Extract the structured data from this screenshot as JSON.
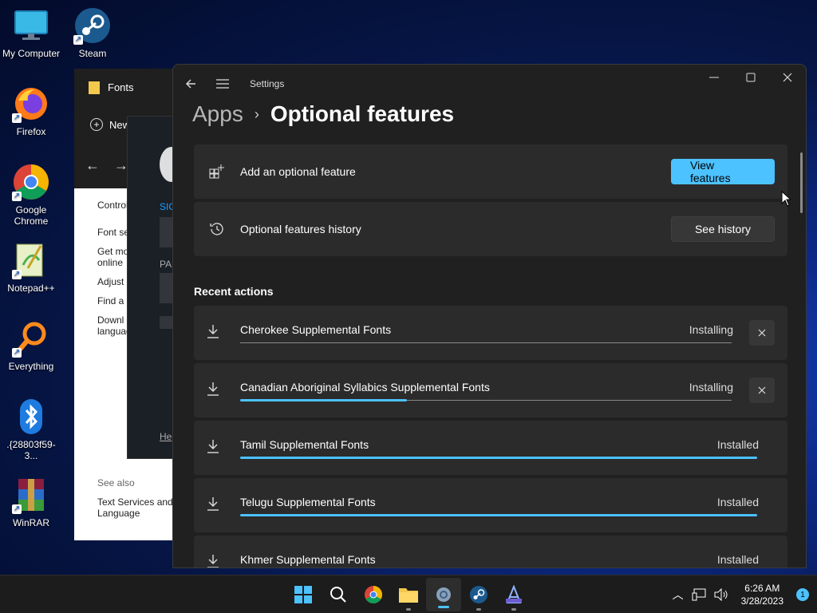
{
  "desktop_icons": [
    {
      "label": "My Computer"
    },
    {
      "label": "Steam"
    },
    {
      "label": "Firefox"
    },
    {
      "label": "Google Chrome"
    },
    {
      "label": "Notepad++"
    },
    {
      "label": "Everything"
    },
    {
      "label": ".{28803f59-3..."
    },
    {
      "label": "WinRAR"
    }
  ],
  "fonts_window": {
    "title": "Fonts",
    "new_label": "New",
    "body_items": [
      "Control",
      "Font se",
      "Get mo online",
      "Adjust",
      "Find a",
      "Downl languag"
    ],
    "see_also": "See also",
    "see_also_link": "Text Services and Language"
  },
  "steam_dialog": {
    "sign_label": "SIG",
    "pass_label": "PA",
    "help_label": "He"
  },
  "settings": {
    "app_title": "Settings",
    "breadcrumb_parent": "Apps",
    "breadcrumb_sep": "›",
    "breadcrumb_current": "Optional features",
    "add_feature": {
      "label": "Add an optional feature",
      "button": "View features"
    },
    "history": {
      "label": "Optional features history",
      "button": "See history"
    },
    "recent_title": "Recent actions",
    "actions": [
      {
        "name": "Cherokee Supplemental Fonts",
        "status": "Installing",
        "progress": 0,
        "cancelable": true
      },
      {
        "name": "Canadian Aboriginal Syllabics Supplemental Fonts",
        "status": "Installing",
        "progress": 0.34,
        "cancelable": true
      },
      {
        "name": "Tamil Supplemental Fonts",
        "status": "Installed",
        "progress": 1,
        "cancelable": false
      },
      {
        "name": "Telugu Supplemental Fonts",
        "status": "Installed",
        "progress": 1,
        "cancelable": false
      },
      {
        "name": "Khmer Supplemental Fonts",
        "status": "Installed",
        "progress": 1,
        "cancelable": false
      }
    ]
  },
  "taskbar": {
    "time": "6:26 AM",
    "date": "3/28/2023",
    "notification_count": "1"
  },
  "colors": {
    "accent": "#4cc2ff"
  }
}
